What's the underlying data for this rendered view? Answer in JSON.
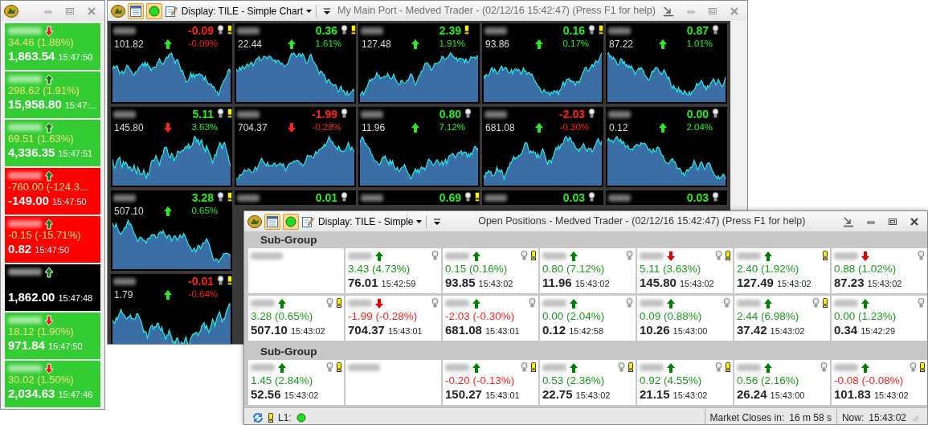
{
  "ticker_window": {
    "items": [
      {
        "color": "#33cc33",
        "rising": false,
        "change": "34.46 (1.88%)",
        "price": "1,863.54",
        "time": "15:47:50"
      },
      {
        "color": "#33cc33",
        "rising": true,
        "change": "298.62 (1.91%)",
        "price": "15,958.80",
        "time": "15:47:..."
      },
      {
        "color": "#33cc33",
        "rising": true,
        "change": "69.51 (1.63%)",
        "price": "4,336.35",
        "time": "15:47:51"
      },
      {
        "color": "#ff0000",
        "rising": true,
        "change": "-760.00 (-124.3...",
        "price": "-149.00",
        "time": "15:47:50"
      },
      {
        "color": "#ff0000",
        "rising": true,
        "change": "-0.15 (-15.71%)",
        "price": "0.82",
        "time": "15:47:50"
      },
      {
        "color": "#000000",
        "rising": true,
        "price": "1,862.00",
        "time": "15:47:48"
      },
      {
        "color": "#33cc33",
        "rising": false,
        "change": "18.12 (1.90%)",
        "price": "971.84",
        "time": "15:47:50"
      },
      {
        "color": "#33cc33",
        "rising": false,
        "change": "30.02 (1.50%)",
        "price": "2,034.63",
        "time": "15:47:46"
      }
    ]
  },
  "main_window": {
    "active": false,
    "display": "Display: TILE - Simple Chart",
    "toggles": [
      {
        "kind": "calendar",
        "selected": true
      },
      {
        "kind": "status",
        "selected": true
      }
    ],
    "title": "My Main Port - Medved Trader - (02/12/16 15:42:47) (Press F1 for help)",
    "tiles": [
      {
        "kind": "full",
        "change": "-0.09",
        "negative": true,
        "note": true,
        "alert": true,
        "price": "101.82",
        "rising": true,
        "percent": "-0.09%"
      },
      {
        "kind": "full",
        "change": "0.36",
        "negative": false,
        "note": true,
        "alert": true,
        "price": "22.44",
        "rising": true,
        "percent": "1.61%"
      },
      {
        "kind": "full",
        "change": "2.39",
        "negative": false,
        "note": false,
        "alert": true,
        "price": "127.48",
        "rising": true,
        "percent": "1.91%"
      },
      {
        "kind": "full",
        "change": "0.16",
        "negative": false,
        "note": true,
        "alert": true,
        "price": "93.86",
        "rising": true,
        "percent": "0.17%"
      },
      {
        "kind": "full",
        "change": "0.87",
        "negative": false,
        "note": true,
        "alert": false,
        "price": "87.22",
        "rising": true,
        "percent": "1.01%"
      },
      {
        "kind": "full",
        "change": "5.11",
        "negative": false,
        "note": true,
        "alert": true,
        "price": "145.80",
        "rising": false,
        "percent": "3.63%"
      },
      {
        "kind": "full",
        "change": "-1.99",
        "negative": true,
        "note": true,
        "alert": false,
        "price": "704.37",
        "rising": false,
        "percent": "-0.28%"
      },
      {
        "kind": "full",
        "change": "0.80",
        "negative": false,
        "note": true,
        "alert": false,
        "price": "11.96",
        "rising": true,
        "percent": "7.12%"
      },
      {
        "kind": "full",
        "change": "-2.03",
        "negative": true,
        "note": true,
        "alert": false,
        "price": "681.08",
        "rising": true,
        "percent": "-0.30%"
      },
      {
        "kind": "full",
        "change": "0.00",
        "negative": false,
        "note": true,
        "alert": false,
        "price": "0.12",
        "rising": true,
        "percent": "2.04%"
      },
      {
        "kind": "full",
        "change": "3.28",
        "negative": false,
        "note": true,
        "alert": true,
        "price": "507.10",
        "rising": true,
        "percent": "0.65%"
      },
      {
        "kind": "partial",
        "change": "0.01",
        "negative": false,
        "note": true,
        "alert": false
      },
      {
        "kind": "partial",
        "change": "0.69",
        "negative": false,
        "note": true,
        "alert": true
      },
      {
        "kind": "partial",
        "change": "0.03",
        "negative": false,
        "note": true,
        "alert": false
      },
      {
        "kind": "partial",
        "change": "0.03",
        "negative": false,
        "note": true,
        "alert": false
      },
      {
        "kind": "full",
        "change": "-0.01",
        "negative": true,
        "note": true,
        "alert": true,
        "price": "1.79",
        "rising": true,
        "percent": "-0.64%"
      }
    ]
  },
  "positions_window": {
    "active": true,
    "display": "Display: TILE - Simple",
    "toggles": [
      {
        "kind": "calendar",
        "selected": true
      },
      {
        "kind": "status",
        "selected": true
      }
    ],
    "title": "Open Positions - Medved Trader - (02/12/16 15:42:47) (Press F1 for help)",
    "groups": [
      {
        "title": "Sub-Group",
        "tiles": [
          {
            "kind": "empty"
          },
          {
            "kind": "quote",
            "rising": true,
            "note": true,
            "alert": false,
            "change": "3.43 (4.73%)",
            "negative": false,
            "price": "76.01",
            "time": "15:42:59"
          },
          {
            "kind": "quote",
            "rising": true,
            "note": true,
            "alert": true,
            "change": "0.15 (0.16%)",
            "negative": false,
            "price": "93.85",
            "time": "15:43:02"
          },
          {
            "kind": "quote",
            "rising": true,
            "note": true,
            "alert": false,
            "change": "0.80 (7.12%)",
            "negative": false,
            "price": "11.96",
            "time": "15:43:02"
          },
          {
            "kind": "quote",
            "rising": false,
            "note": true,
            "alert": true,
            "change": "5.11 (3.63%)",
            "negative": false,
            "price": "145.80",
            "time": "15:43:02"
          },
          {
            "kind": "quote",
            "rising": true,
            "note": false,
            "alert": true,
            "change": "2.40 (1.92%)",
            "negative": false,
            "price": "127.49",
            "time": "15:43:02"
          },
          {
            "kind": "quote",
            "rising": false,
            "note": true,
            "alert": false,
            "change": "0.88 (1.02%)",
            "negative": false,
            "price": "87.23",
            "time": "15:43:02"
          },
          {
            "kind": "quote",
            "rising": true,
            "note": true,
            "alert": true,
            "change": "3.28 (0.65%)",
            "negative": false,
            "price": "507.10",
            "time": "15:43:02"
          },
          {
            "kind": "quote",
            "rising": false,
            "note": true,
            "alert": false,
            "change": "-1.99 (-0.28%)",
            "negative": true,
            "price": "704.37",
            "time": "15:43:01"
          },
          {
            "kind": "quote",
            "rising": true,
            "note": true,
            "alert": false,
            "change": "-2.03 (-0.30%)",
            "negative": true,
            "price": "681.08",
            "time": "15:43:01"
          },
          {
            "kind": "quote",
            "rising": true,
            "note": true,
            "alert": false,
            "change": "0.00 (2.04%)",
            "negative": false,
            "price": "0.12",
            "time": "15:42:58"
          },
          {
            "kind": "quote",
            "rising": true,
            "note": true,
            "alert": false,
            "change": "0.09 (0.88%)",
            "negative": false,
            "price": "10.26",
            "time": "15:43:00"
          },
          {
            "kind": "quote",
            "rising": true,
            "note": true,
            "alert": true,
            "change": "2.44 (6.98%)",
            "negative": false,
            "price": "37.42",
            "time": "15:43:02"
          },
          {
            "kind": "quote",
            "rising": true,
            "note": true,
            "alert": false,
            "change": "0.00 (1.23%)",
            "negative": false,
            "price": "0.34",
            "time": "15:42:29"
          }
        ]
      },
      {
        "title": "Sub-Group",
        "tiles": [
          {
            "kind": "quote",
            "rising": true,
            "note": true,
            "alert": true,
            "change": "1.45 (2.84%)",
            "negative": false,
            "price": "52.56",
            "time": "15:43:02"
          },
          {
            "kind": "empty"
          },
          {
            "kind": "quote",
            "rising": true,
            "note": true,
            "alert": true,
            "change": "-0.20 (-0.13%)",
            "negative": true,
            "price": "150.27",
            "time": "15:43:01"
          },
          {
            "kind": "quote",
            "rising": true,
            "note": true,
            "alert": true,
            "change": "0.53 (2.36%)",
            "negative": false,
            "price": "22.75",
            "time": "15:43:02"
          },
          {
            "kind": "quote",
            "rising": true,
            "note": true,
            "alert": true,
            "change": "0.92 (4.55%)",
            "negative": false,
            "price": "21.15",
            "time": "15:43:02"
          },
          {
            "kind": "quote",
            "rising": true,
            "note": true,
            "alert": false,
            "change": "0.56 (2.16%)",
            "negative": false,
            "price": "26.24",
            "time": "15:43:00"
          },
          {
            "kind": "quote",
            "rising": true,
            "note": true,
            "alert": true,
            "change": "-0.08 (-0.08%)",
            "negative": true,
            "price": "101.83",
            "time": "15:43:02"
          }
        ]
      }
    ],
    "status_bar": {
      "feed_label": "L1:",
      "closes_label": "Market Closes in:",
      "closes_value": "16 m 58 s",
      "now_label": "Now:",
      "now_value": "15:43:02"
    }
  }
}
